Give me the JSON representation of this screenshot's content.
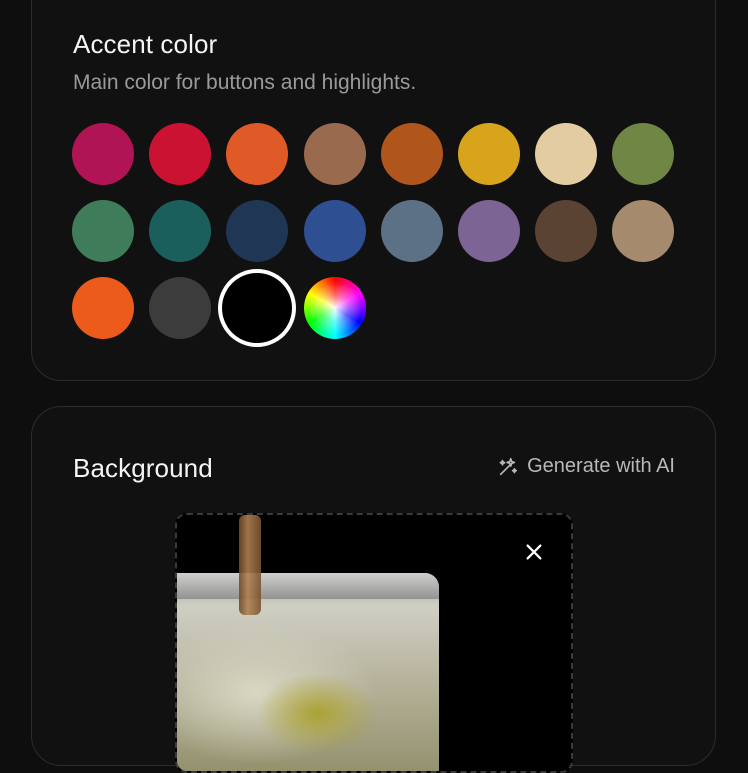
{
  "accent": {
    "title": "Accent color",
    "subtitle": "Main color for buttons and highlights.",
    "swatches": [
      {
        "color": "#b01454"
      },
      {
        "color": "#cc1233"
      },
      {
        "color": "#e05a28"
      },
      {
        "color": "#9a6a4e"
      },
      {
        "color": "#b0561c"
      },
      {
        "color": "#d8a41c"
      },
      {
        "color": "#e3cca2"
      },
      {
        "color": "#6f8645"
      },
      {
        "color": "#3f7c5a"
      },
      {
        "color": "#1b5f5c"
      },
      {
        "color": "#1f3654"
      },
      {
        "color": "#2f4f93"
      },
      {
        "color": "#5d7186"
      },
      {
        "color": "#7c6494"
      },
      {
        "color": "#5b4333"
      },
      {
        "color": "#a68a6d"
      },
      {
        "color": "#ec5a1c"
      },
      {
        "color": "#3c3c3c"
      },
      {
        "color": "#000000",
        "selected": true
      },
      {
        "color": "rainbow",
        "icon": "color-wheel-icon"
      }
    ]
  },
  "background": {
    "title": "Background",
    "generate_label": "Generate with AI",
    "generate_icon": "sparkles-icon",
    "image_alt": "Glass of iced drink being poured",
    "close_icon": "close-icon"
  }
}
